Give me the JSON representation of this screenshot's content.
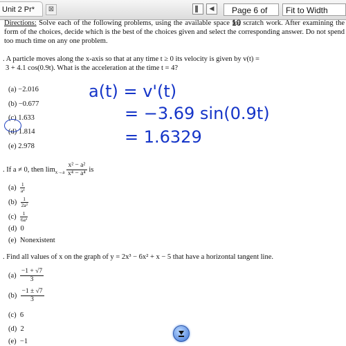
{
  "toolbar": {
    "tab_title": "Unit 2 Pr*",
    "close_glyph": "⊠",
    "page_label": "Page 6 of 10",
    "zoom_value": "Fit to Width",
    "icons": [
      "sidebar-icon",
      "previous-page-icon",
      "next-page-icon",
      "dropdown-arrow-icon"
    ]
  },
  "directions": {
    "label": "Directions:",
    "text": " Solve each of the following problems, using the available space for scratch work. After examining the form of the choices, decide which is the best of the choices given and select the corresponding answer. Do not spend too much time on any one problem."
  },
  "questions": [
    {
      "stem_line1": ". A particle moves along the x-axis so that at any time t ≥ 0 its velocity is given by v(t) =",
      "stem_line2": "3 + 4.1 cos(0.9t). What is the acceleration at the time t = 4?",
      "options": [
        "(a)  −2.016",
        "(b)  −0.677",
        "(c) 1.633",
        "(d)  1.814",
        "(e)  2.978"
      ]
    },
    {
      "stem_prefix": ". If a ≠ 0, then lim",
      "stem_sub": "x→a",
      "stem_num": "x² − a²",
      "stem_den": "x⁴ − a⁴",
      "stem_suffix": "is",
      "options": [
        {
          "label": "(a)",
          "num": "1",
          "den": "a²"
        },
        {
          "label": "(b)",
          "num": "1",
          "den": "2a²"
        },
        {
          "label": "(c)",
          "num": "1",
          "den": "6a²"
        },
        {
          "label": "(d)",
          "text": "0"
        },
        {
          "label": "(e)",
          "text": "Nonexistent"
        }
      ]
    },
    {
      "stem": ". Find all values of x on the graph of y = 2x³ − 6x² + x − 5 that have a horizontal tangent line.",
      "options": [
        {
          "label": "(a)",
          "num": "−1 + √7",
          "den": "3"
        },
        {
          "label": "(b)",
          "num": "−1 ± √7",
          "den": "3"
        },
        {
          "label": "(c)",
          "text": "6"
        },
        {
          "label": "(d)",
          "text": "2"
        },
        {
          "label": "(e)",
          "text": "−1"
        }
      ]
    }
  ],
  "handwriting": {
    "line1": "a(t) = v'(t)",
    "line2": "= −3.69 sin(0.9t)",
    "line3": "= 1.6329",
    "color": "#1535c8"
  }
}
